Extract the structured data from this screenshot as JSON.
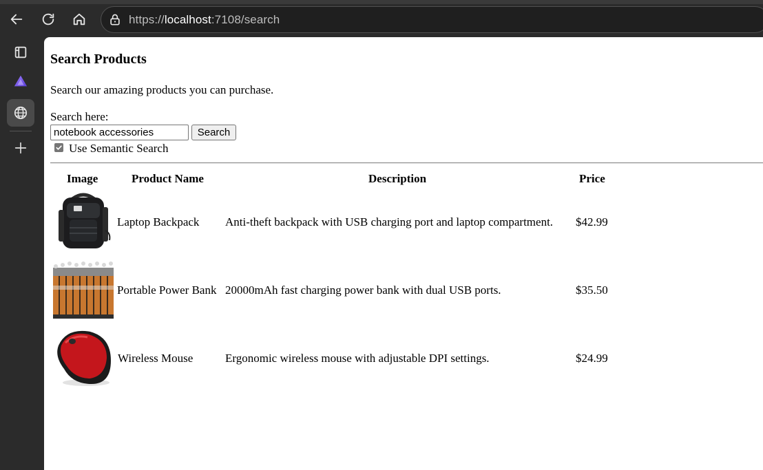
{
  "browser": {
    "url_scheme": "https://",
    "url_host": "localhost",
    "url_rest": ":7108/search"
  },
  "page": {
    "title": "Search Products",
    "intro": "Search our amazing products you can purchase.",
    "search_label": "Search here:",
    "search_value": "notebook accessories",
    "search_button": "Search",
    "semantic_checked": true,
    "semantic_label": "Use Semantic Search"
  },
  "table": {
    "headers": [
      "Image",
      "Product Name",
      "Description",
      "Price"
    ],
    "rows": [
      {
        "name": "Laptop Backpack",
        "description": "Anti-theft backpack with USB charging port and laptop compartment.",
        "price": "$42.99",
        "image": "backpack-image"
      },
      {
        "name": "Portable Power Bank",
        "description": "20000mAh fast charging power bank with dual USB ports.",
        "price": "$35.50",
        "image": "batteries-image"
      },
      {
        "name": "Wireless Mouse",
        "description": "Ergonomic wireless mouse with adjustable DPI settings.",
        "price": "$24.99",
        "image": "mouse-image"
      }
    ]
  }
}
